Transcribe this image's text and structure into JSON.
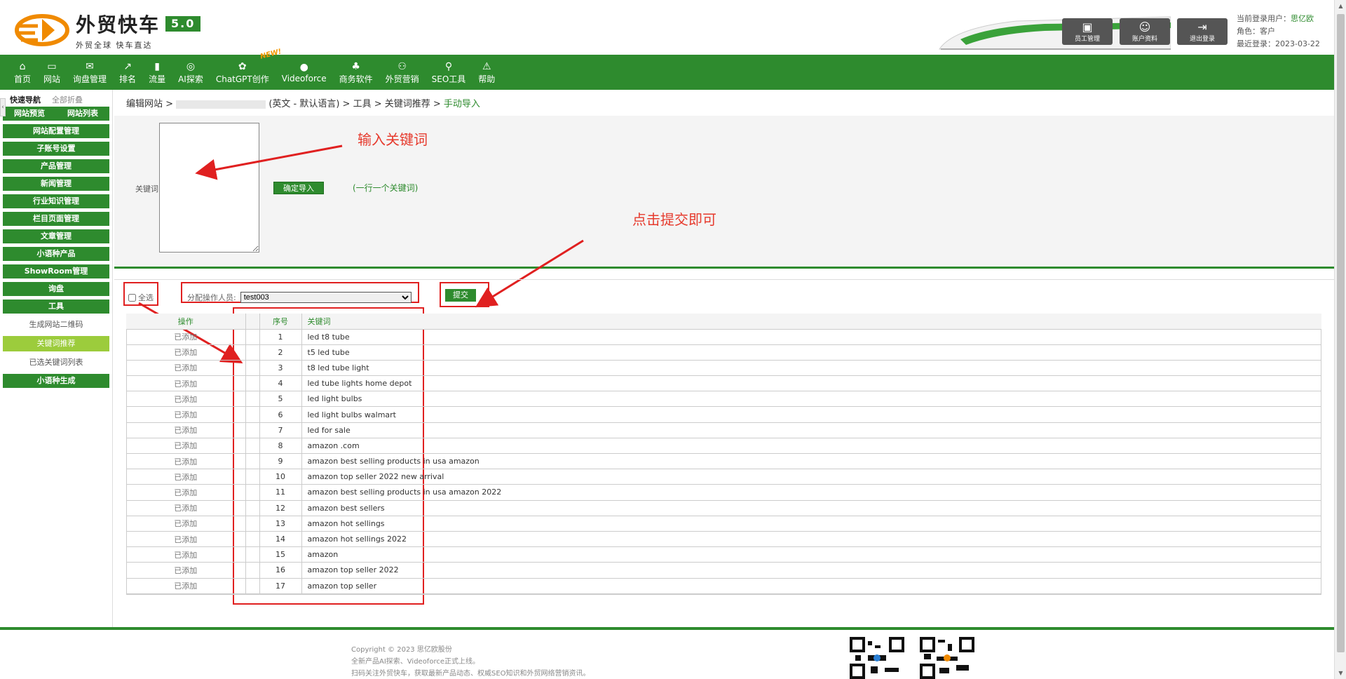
{
  "header": {
    "logo_title": "外贸快车",
    "logo_version": "5.0",
    "logo_subtitle": "外贸全球 快车直达",
    "buttons": [
      {
        "label": "员工管理",
        "icon": "staff-icon"
      },
      {
        "label": "账户资料",
        "icon": "account-icon"
      },
      {
        "label": "退出登录",
        "icon": "logout-icon"
      }
    ],
    "user_label": "当前登录用户：",
    "user_name": "思亿欧",
    "role_label": "角色：",
    "role_value": "客户",
    "last_login_label": "最近登录：",
    "last_login_value": "2023-03-22"
  },
  "nav": {
    "items": [
      {
        "label": "首页",
        "icon": "home-icon"
      },
      {
        "label": "网站",
        "icon": "monitor-icon"
      },
      {
        "label": "询盘管理",
        "icon": "mail-icon"
      },
      {
        "label": "排名",
        "icon": "ranking-icon"
      },
      {
        "label": "流量",
        "icon": "traffic-icon"
      },
      {
        "label": "AI探索",
        "icon": "ai-icon"
      },
      {
        "label": "ChatGPT创作",
        "icon": "chatgpt-icon",
        "badge": "NEW!"
      },
      {
        "label": "Videoforce",
        "icon": "video-icon"
      },
      {
        "label": "商务软件",
        "icon": "business-icon"
      },
      {
        "label": "外贸营销",
        "icon": "marketing-icon"
      },
      {
        "label": "SEO工具",
        "icon": "search-icon"
      },
      {
        "label": "帮助",
        "icon": "help-icon"
      }
    ]
  },
  "sidebar": {
    "tab_quick": "快速导航",
    "tab_collapse": "全部折叠",
    "btn_preview": "网站预览",
    "btn_list": "网站列表",
    "items": [
      "网站配置管理",
      "子账号设置",
      "产品管理",
      "新闻管理",
      "行业知识管理",
      "栏目页面管理",
      "文章管理",
      "小语种产品",
      "ShowRoom管理",
      "询盘",
      "工具"
    ],
    "sub_items": [
      "生成网站二维码",
      "关键词推荐",
      "已选关键词列表"
    ],
    "last_item": "小语种生成"
  },
  "breadcrumb": {
    "prefix": "编辑网站 >",
    "middle": "(英文 - 默认语言) > 工具 > 关键词推荐 >",
    "current": "手动导入"
  },
  "form": {
    "kw_label": "关键词",
    "confirm_button": "确定导入",
    "hint": "(一行一个关键词)"
  },
  "annotations": {
    "input_kw": "输入关键词",
    "click_submit": "点击提交即可"
  },
  "toolbar": {
    "select_all": "全选",
    "assign_label": "分配操作人员:",
    "assign_value": "test003",
    "submit": "提交"
  },
  "table": {
    "headers": {
      "op": "操作",
      "no": "序号",
      "kw": "关键词"
    },
    "rows": [
      {
        "op": "已添加",
        "no": "1",
        "kw": "led t8 tube"
      },
      {
        "op": "已添加",
        "no": "2",
        "kw": "t5 led tube"
      },
      {
        "op": "已添加",
        "no": "3",
        "kw": "t8 led tube light"
      },
      {
        "op": "已添加",
        "no": "4",
        "kw": "led tube lights home depot"
      },
      {
        "op": "已添加",
        "no": "5",
        "kw": "led light bulbs"
      },
      {
        "op": "已添加",
        "no": "6",
        "kw": "led light bulbs walmart"
      },
      {
        "op": "已添加",
        "no": "7",
        "kw": "led for sale"
      },
      {
        "op": "已添加",
        "no": "8",
        "kw": "amazon .com"
      },
      {
        "op": "已添加",
        "no": "9",
        "kw": "amazon best selling products in usa amazon"
      },
      {
        "op": "已添加",
        "no": "10",
        "kw": "amazon top seller 2022 new arrival"
      },
      {
        "op": "已添加",
        "no": "11",
        "kw": "amazon best selling products in usa amazon 2022"
      },
      {
        "op": "已添加",
        "no": "12",
        "kw": "amazon best sellers"
      },
      {
        "op": "已添加",
        "no": "13",
        "kw": "amazon hot sellings"
      },
      {
        "op": "已添加",
        "no": "14",
        "kw": "amazon hot sellings 2022"
      },
      {
        "op": "已添加",
        "no": "15",
        "kw": "amazon"
      },
      {
        "op": "已添加",
        "no": "16",
        "kw": "amazon top seller 2022"
      },
      {
        "op": "已添加",
        "no": "17",
        "kw": "amazon top seller"
      }
    ]
  },
  "footer": {
    "line1": "Copyright © 2023 思亿欧股份",
    "line2": "全新产品AI探索、Videoforce正式上线。",
    "line3": "扫码关注外贸快车，获取最新产品动态、权威SEO知识和外贸网络营销资讯。"
  },
  "colors": {
    "brand_green": "#2e8b2e",
    "annotation_red": "#e02020",
    "active_sub": "#9ccc3c"
  }
}
